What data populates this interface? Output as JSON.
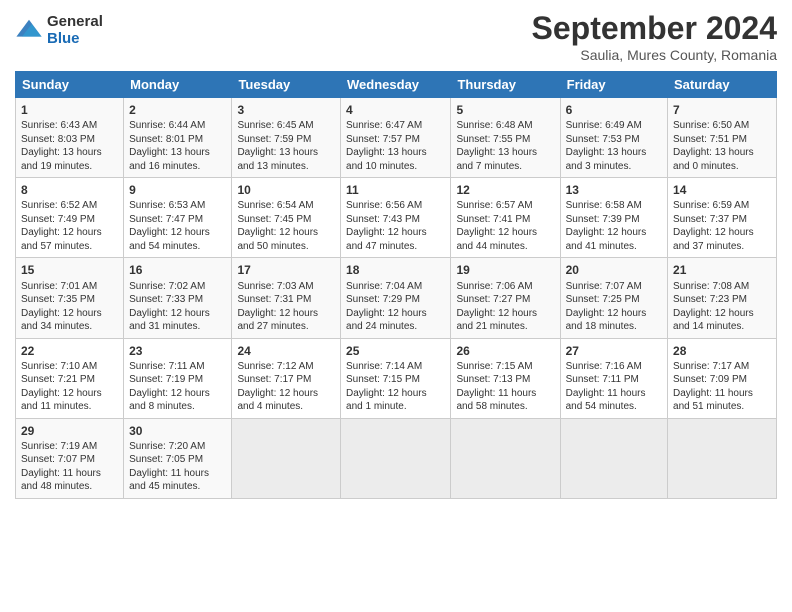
{
  "header": {
    "logo": {
      "general": "General",
      "blue": "Blue"
    },
    "title": "September 2024",
    "location": "Saulia, Mures County, Romania"
  },
  "days_of_week": [
    "Sunday",
    "Monday",
    "Tuesday",
    "Wednesday",
    "Thursday",
    "Friday",
    "Saturday"
  ],
  "weeks": [
    [
      {
        "day": "1",
        "sunrise": "Sunrise: 6:43 AM",
        "sunset": "Sunset: 8:03 PM",
        "daylight": "Daylight: 13 hours and 19 minutes."
      },
      {
        "day": "2",
        "sunrise": "Sunrise: 6:44 AM",
        "sunset": "Sunset: 8:01 PM",
        "daylight": "Daylight: 13 hours and 16 minutes."
      },
      {
        "day": "3",
        "sunrise": "Sunrise: 6:45 AM",
        "sunset": "Sunset: 7:59 PM",
        "daylight": "Daylight: 13 hours and 13 minutes."
      },
      {
        "day": "4",
        "sunrise": "Sunrise: 6:47 AM",
        "sunset": "Sunset: 7:57 PM",
        "daylight": "Daylight: 13 hours and 10 minutes."
      },
      {
        "day": "5",
        "sunrise": "Sunrise: 6:48 AM",
        "sunset": "Sunset: 7:55 PM",
        "daylight": "Daylight: 13 hours and 7 minutes."
      },
      {
        "day": "6",
        "sunrise": "Sunrise: 6:49 AM",
        "sunset": "Sunset: 7:53 PM",
        "daylight": "Daylight: 13 hours and 3 minutes."
      },
      {
        "day": "7",
        "sunrise": "Sunrise: 6:50 AM",
        "sunset": "Sunset: 7:51 PM",
        "daylight": "Daylight: 13 hours and 0 minutes."
      }
    ],
    [
      {
        "day": "8",
        "sunrise": "Sunrise: 6:52 AM",
        "sunset": "Sunset: 7:49 PM",
        "daylight": "Daylight: 12 hours and 57 minutes."
      },
      {
        "day": "9",
        "sunrise": "Sunrise: 6:53 AM",
        "sunset": "Sunset: 7:47 PM",
        "daylight": "Daylight: 12 hours and 54 minutes."
      },
      {
        "day": "10",
        "sunrise": "Sunrise: 6:54 AM",
        "sunset": "Sunset: 7:45 PM",
        "daylight": "Daylight: 12 hours and 50 minutes."
      },
      {
        "day": "11",
        "sunrise": "Sunrise: 6:56 AM",
        "sunset": "Sunset: 7:43 PM",
        "daylight": "Daylight: 12 hours and 47 minutes."
      },
      {
        "day": "12",
        "sunrise": "Sunrise: 6:57 AM",
        "sunset": "Sunset: 7:41 PM",
        "daylight": "Daylight: 12 hours and 44 minutes."
      },
      {
        "day": "13",
        "sunrise": "Sunrise: 6:58 AM",
        "sunset": "Sunset: 7:39 PM",
        "daylight": "Daylight: 12 hours and 41 minutes."
      },
      {
        "day": "14",
        "sunrise": "Sunrise: 6:59 AM",
        "sunset": "Sunset: 7:37 PM",
        "daylight": "Daylight: 12 hours and 37 minutes."
      }
    ],
    [
      {
        "day": "15",
        "sunrise": "Sunrise: 7:01 AM",
        "sunset": "Sunset: 7:35 PM",
        "daylight": "Daylight: 12 hours and 34 minutes."
      },
      {
        "day": "16",
        "sunrise": "Sunrise: 7:02 AM",
        "sunset": "Sunset: 7:33 PM",
        "daylight": "Daylight: 12 hours and 31 minutes."
      },
      {
        "day": "17",
        "sunrise": "Sunrise: 7:03 AM",
        "sunset": "Sunset: 7:31 PM",
        "daylight": "Daylight: 12 hours and 27 minutes."
      },
      {
        "day": "18",
        "sunrise": "Sunrise: 7:04 AM",
        "sunset": "Sunset: 7:29 PM",
        "daylight": "Daylight: 12 hours and 24 minutes."
      },
      {
        "day": "19",
        "sunrise": "Sunrise: 7:06 AM",
        "sunset": "Sunset: 7:27 PM",
        "daylight": "Daylight: 12 hours and 21 minutes."
      },
      {
        "day": "20",
        "sunrise": "Sunrise: 7:07 AM",
        "sunset": "Sunset: 7:25 PM",
        "daylight": "Daylight: 12 hours and 18 minutes."
      },
      {
        "day": "21",
        "sunrise": "Sunrise: 7:08 AM",
        "sunset": "Sunset: 7:23 PM",
        "daylight": "Daylight: 12 hours and 14 minutes."
      }
    ],
    [
      {
        "day": "22",
        "sunrise": "Sunrise: 7:10 AM",
        "sunset": "Sunset: 7:21 PM",
        "daylight": "Daylight: 12 hours and 11 minutes."
      },
      {
        "day": "23",
        "sunrise": "Sunrise: 7:11 AM",
        "sunset": "Sunset: 7:19 PM",
        "daylight": "Daylight: 12 hours and 8 minutes."
      },
      {
        "day": "24",
        "sunrise": "Sunrise: 7:12 AM",
        "sunset": "Sunset: 7:17 PM",
        "daylight": "Daylight: 12 hours and 4 minutes."
      },
      {
        "day": "25",
        "sunrise": "Sunrise: 7:14 AM",
        "sunset": "Sunset: 7:15 PM",
        "daylight": "Daylight: 12 hours and 1 minute."
      },
      {
        "day": "26",
        "sunrise": "Sunrise: 7:15 AM",
        "sunset": "Sunset: 7:13 PM",
        "daylight": "Daylight: 11 hours and 58 minutes."
      },
      {
        "day": "27",
        "sunrise": "Sunrise: 7:16 AM",
        "sunset": "Sunset: 7:11 PM",
        "daylight": "Daylight: 11 hours and 54 minutes."
      },
      {
        "day": "28",
        "sunrise": "Sunrise: 7:17 AM",
        "sunset": "Sunset: 7:09 PM",
        "daylight": "Daylight: 11 hours and 51 minutes."
      }
    ],
    [
      {
        "day": "29",
        "sunrise": "Sunrise: 7:19 AM",
        "sunset": "Sunset: 7:07 PM",
        "daylight": "Daylight: 11 hours and 48 minutes."
      },
      {
        "day": "30",
        "sunrise": "Sunrise: 7:20 AM",
        "sunset": "Sunset: 7:05 PM",
        "daylight": "Daylight: 11 hours and 45 minutes."
      },
      {
        "day": "",
        "sunrise": "",
        "sunset": "",
        "daylight": ""
      },
      {
        "day": "",
        "sunrise": "",
        "sunset": "",
        "daylight": ""
      },
      {
        "day": "",
        "sunrise": "",
        "sunset": "",
        "daylight": ""
      },
      {
        "day": "",
        "sunrise": "",
        "sunset": "",
        "daylight": ""
      },
      {
        "day": "",
        "sunrise": "",
        "sunset": "",
        "daylight": ""
      }
    ]
  ]
}
